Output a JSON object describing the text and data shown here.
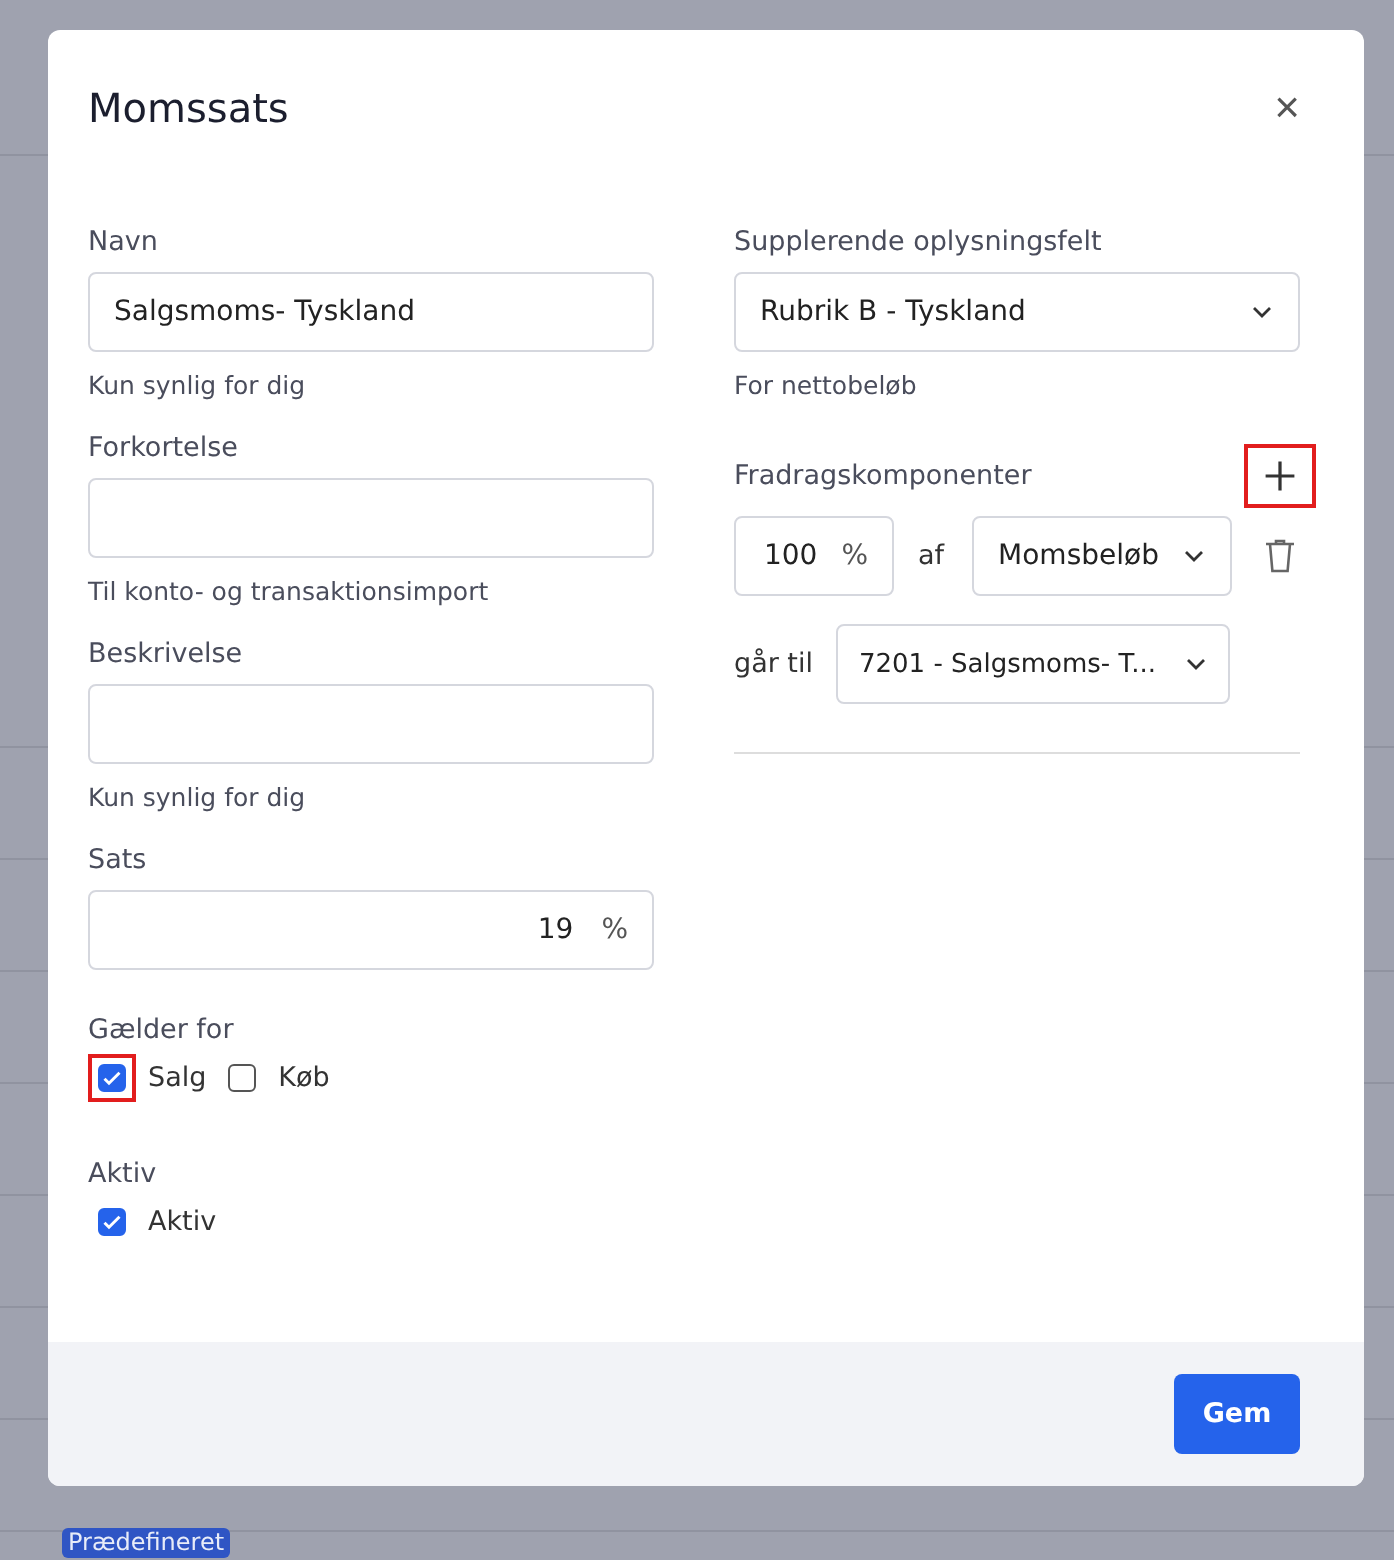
{
  "background": {
    "badge": "Prædefineret"
  },
  "dialog": {
    "title": "Momssats",
    "close": "×",
    "left": {
      "name": {
        "label": "Navn",
        "value": "Salgsmoms- Tyskland",
        "hint": "Kun synlig for dig"
      },
      "abbreviation": {
        "label": "Forkortelse",
        "hint": "Til konto- og transaktionsimport"
      },
      "description": {
        "label": "Beskrivelse",
        "hint": "Kun synlig for dig"
      },
      "rate": {
        "label": "Sats",
        "value": "19",
        "unit": "%"
      },
      "applies_to": {
        "label": "Gælder for",
        "options": [
          {
            "label": "Salg",
            "checked": true,
            "highlighted": true
          },
          {
            "label": "Køb",
            "checked": false,
            "highlighted": false
          }
        ]
      },
      "active": {
        "label": "Aktiv",
        "options": [
          {
            "label": "Aktiv",
            "checked": true,
            "highlighted": false
          }
        ]
      }
    },
    "right": {
      "supplementary": {
        "label": "Supplerende oplysningsfelt",
        "value": "Rubrik B - Tyskland",
        "hint": "For nettobeløb"
      },
      "deductions": {
        "label": "Fradragskomponenter",
        "add_highlighted": true,
        "percent": "100",
        "unit": "%",
        "of_label": "af",
        "of_value": "Momsbeløb",
        "to_label": "går til",
        "to_value": "7201 - Salgsmoms- T..."
      }
    },
    "save": "Gem"
  }
}
